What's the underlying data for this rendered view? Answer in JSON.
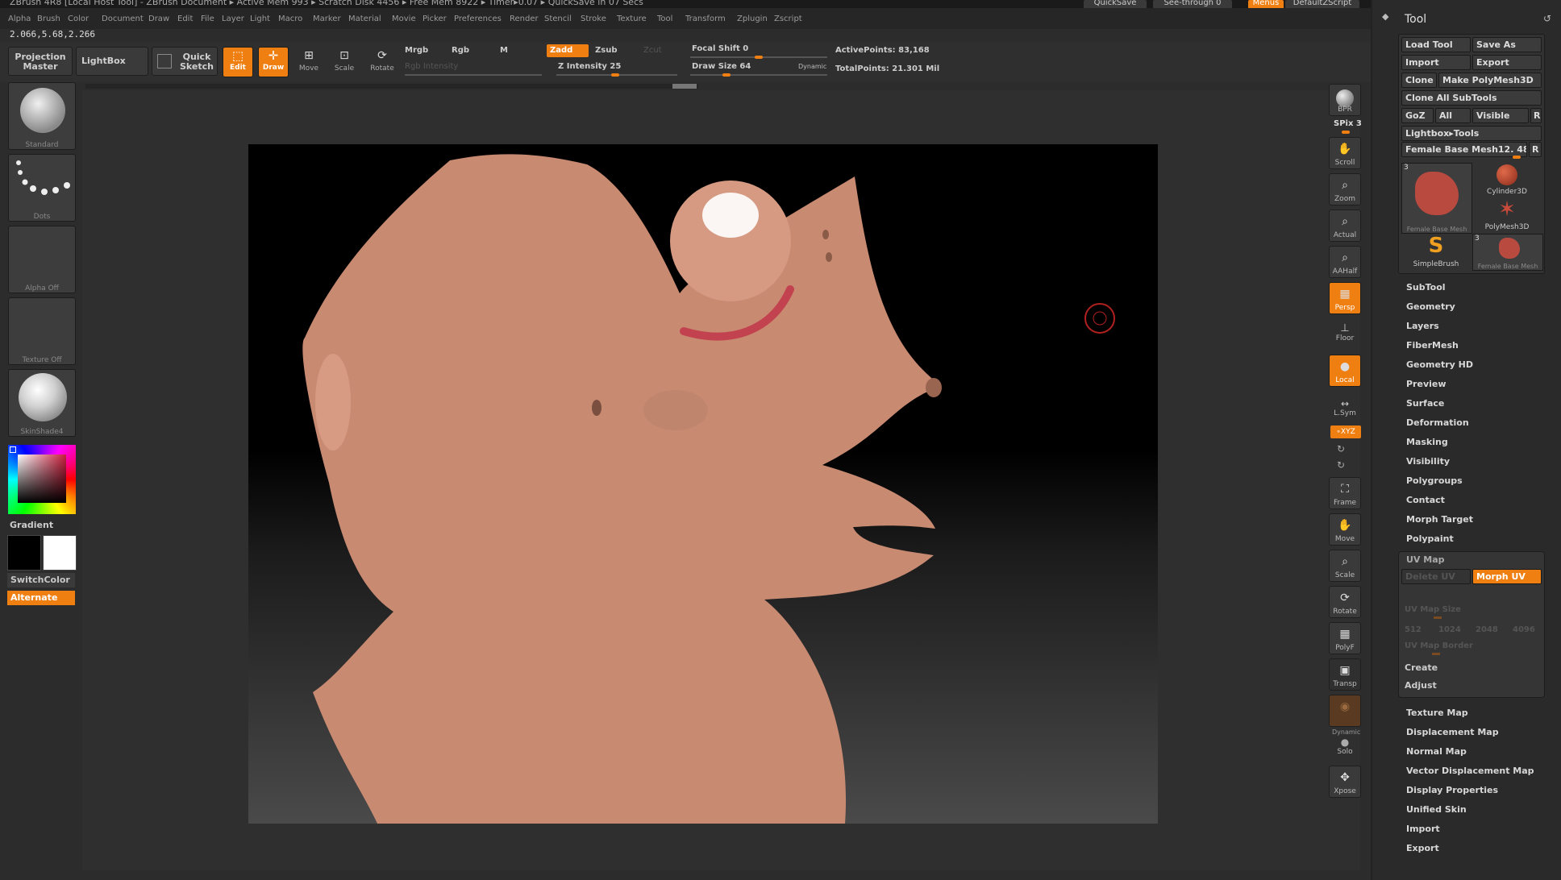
{
  "title_bar": "ZBrush 4R8 [Local Host Tool] - ZBrush Document   ▸ Active Mem 993 ▸ Scratch Disk 4456 ▸ Free Mem 8922 ▸ Timer▸0.07 ▸ QuickSave in 07 Secs",
  "quicksave_label": "QuickSave",
  "seethrough_label": "See-through 0",
  "menus_label": "Menus",
  "defaultscript_label": "DefaultZScript",
  "menu_items": [
    "Alpha",
    "Brush",
    "Color",
    "Document",
    "Draw",
    "Edit",
    "File",
    "Layer",
    "Light",
    "Macro",
    "Marker",
    "Material",
    "Movie",
    "Picker",
    "Preferences",
    "Render",
    "Stencil",
    "Stroke",
    "Texture",
    "Tool",
    "Transform",
    "Zplugin",
    "Zscript"
  ],
  "coords": "2.066,5.68,2.266",
  "topbar": {
    "projection_master": "Projection Master",
    "lightbox": "LightBox",
    "quick_sketch": "Quick Sketch",
    "edit": "Edit",
    "draw": "Draw",
    "move": "Move",
    "scale": "Scale",
    "rotate": "Rotate",
    "mrgb": "Mrgb",
    "rgb": "Rgb",
    "m": "M",
    "zadd": "Zadd",
    "zsub": "Zsub",
    "zcut": "Zcut",
    "rgb_intensity": "Rgb Intensity",
    "z_intensity": "Z Intensity 25",
    "focal_shift": "Focal Shift 0",
    "draw_size": "Draw Size 64",
    "dynamic": "Dynamic",
    "active_points": "ActivePoints: 83,168",
    "total_points": "TotalPoints: 21.301 Mil"
  },
  "left": {
    "brush": "Standard",
    "stroke": "Dots",
    "alpha": "Alpha Off",
    "texture": "Texture Off",
    "material": "SkinShade4",
    "gradient": "Gradient",
    "switch_color": "SwitchColor",
    "alternate": "Alternate"
  },
  "right_toolbar": {
    "bpr": "BPR",
    "spix": "SPix 3",
    "scroll": "Scroll",
    "zoom": "Zoom",
    "actual": "Actual",
    "aahalf": "AAHalf",
    "persp": "Persp",
    "floor": "Floor",
    "local": "Local",
    "lsym": "L.Sym",
    "xyz": "∘XYZ",
    "frame": "Frame",
    "move": "Move",
    "scale": "Scale",
    "rotate": "Rotate",
    "polyf": "PolyF",
    "transp": "Transp",
    "dynamic": "Dynamic",
    "solo": "Solo",
    "xpose": "Xpose"
  },
  "tool_panel": {
    "title": "Tool",
    "load_tool": "Load Tool",
    "save_as": "Save As",
    "import": "Import",
    "export": "Export",
    "clone": "Clone",
    "make_polymesh": "Make PolyMesh3D",
    "clone_all": "Clone All SubTools",
    "goz": "GoZ",
    "all": "All",
    "visible": "Visible",
    "r": "R",
    "lightbox_tools": "Lightbox▸Tools",
    "current_tool": "Female Base Mesh12. 48",
    "thumbs": [
      {
        "label": "Female Base Mesh",
        "count": "3"
      },
      {
        "label": "Cylinder3D"
      },
      {
        "label": "PolyMesh3D"
      },
      {
        "label": "SimpleBrush"
      },
      {
        "label": "Female Base Mesh",
        "count": "3"
      }
    ],
    "sections": [
      "SubTool",
      "Geometry",
      "Layers",
      "FiberMesh",
      "Geometry HD",
      "Preview",
      "Surface",
      "Deformation",
      "Masking",
      "Visibility",
      "Polygroups",
      "Contact",
      "Morph Target",
      "Polypaint"
    ],
    "uvmap": {
      "title": "UV Map",
      "delete_uv": "Delete UV",
      "morph_uv": "Morph UV",
      "size_label": "UV Map Size",
      "sizes": [
        "512",
        "1024",
        "2048",
        "4096"
      ],
      "border_label": "UV Map Border",
      "create": "Create",
      "adjust": "Adjust"
    },
    "sections_after": [
      "Texture Map",
      "Displacement Map",
      "Normal Map",
      "Vector Displacement Map",
      "Display Properties",
      "Unified Skin",
      "Import",
      "Export"
    ]
  }
}
